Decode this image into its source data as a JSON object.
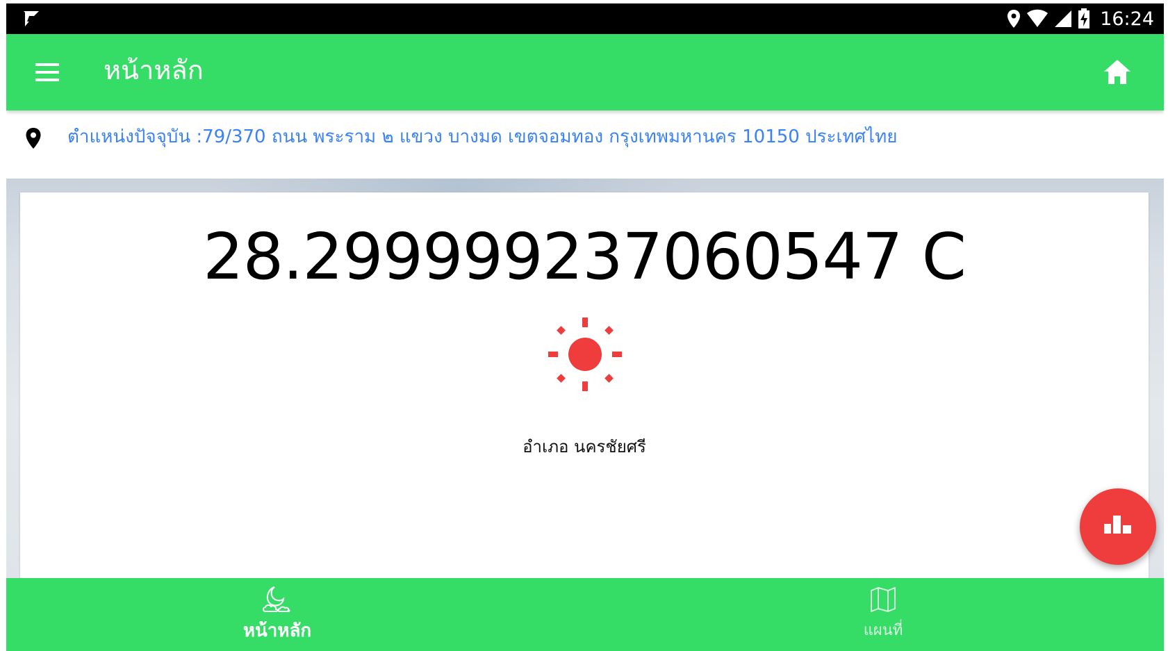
{
  "status_bar": {
    "time": "16:24",
    "icons": [
      "notification-icon",
      "location-icon",
      "wifi-icon",
      "signal-icon",
      "battery-charging-icon"
    ]
  },
  "app_bar": {
    "title": "หน้าหลัก",
    "menu_icon": "hamburger-menu-icon",
    "home_icon": "home-icon"
  },
  "location": {
    "icon": "map-pin-icon",
    "text": "ตำแหน่งปัจจุบัน :79/370 ถนน พระราม ๒ แขวง บางมด เขตจอมทอง กรุงเทพมหานคร 10150 ประเทศไทย"
  },
  "weather": {
    "temperature": "28.299999237060547 C",
    "condition_icon": "sun-icon",
    "district": "อำเภอ นครชัยศรี"
  },
  "fab": {
    "icon": "bar-chart-icon"
  },
  "bottom_nav": {
    "items": [
      {
        "label": "หน้าหลัก",
        "icon": "weather-moon-cloud-icon",
        "active": true
      },
      {
        "label": "แผนที่",
        "icon": "map-icon",
        "active": false
      }
    ]
  },
  "colors": {
    "primary_green": "#35dc66",
    "accent_red": "#ef3c3c",
    "link_blue": "#3b82f6",
    "status_bar": "#000000"
  }
}
